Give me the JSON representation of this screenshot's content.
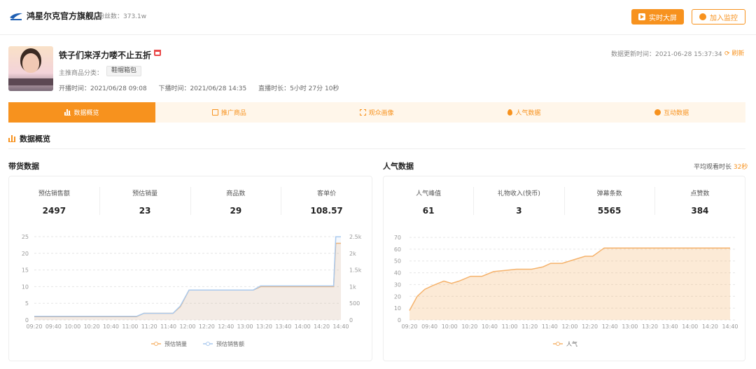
{
  "header": {
    "shop_name": "鸿星尔克官方旗舰店",
    "fans": "粉丝数：373.1w",
    "live_screen_label": "实时大屏",
    "monitor_label": "加入监控"
  },
  "live": {
    "title": "铁子们来浮力喽不止五折",
    "category_label": "主推商品分类：",
    "category_tag": "鞋帽箱包",
    "start_time": "开播时间：2021/06/28 09:08",
    "end_time": "下播时间：2021/06/28 14:35",
    "duration": "直播时长：5小时 27分 10秒",
    "updated": "数据更新时间：2021-06-28 15:37:34",
    "refresh": "刷新"
  },
  "tabs": [
    {
      "label": "数据概览",
      "icon": "bar-chart-icon",
      "active": true
    },
    {
      "label": "推广商品",
      "icon": "shopping-bag-icon",
      "active": false
    },
    {
      "label": "观众画像",
      "icon": "portrait-frame-icon",
      "active": false
    },
    {
      "label": "人气数据",
      "icon": "fire-icon",
      "active": false
    },
    {
      "label": "互动数据",
      "icon": "chat-icon",
      "active": false
    }
  ],
  "section_title": "数据概览",
  "sales": {
    "title": "带货数据",
    "stats": [
      {
        "label": "预估销售额",
        "value": "2497"
      },
      {
        "label": "预估销量",
        "value": "23"
      },
      {
        "label": "商品数",
        "value": "29"
      },
      {
        "label": "客单价",
        "value": "108.57"
      }
    ]
  },
  "popularity": {
    "title": "人气数据",
    "avg_watch_label": "平均观看时长",
    "avg_watch_value": "32秒",
    "stats": [
      {
        "label": "人气峰值",
        "value": "61"
      },
      {
        "label": "礼物收入(快币)",
        "value": "3"
      },
      {
        "label": "弹幕条数",
        "value": "5565"
      },
      {
        "label": "点赞数",
        "value": "384"
      }
    ]
  },
  "colors": {
    "accent": "#f7921e",
    "series_orange": "#f5b26b",
    "series_blue": "#a9c9ee"
  },
  "chart_data": [
    {
      "type": "line",
      "x": [
        "09:20",
        "09:40",
        "10:00",
        "10:20",
        "10:40",
        "11:00",
        "11:20",
        "11:40",
        "12:00",
        "12:20",
        "12:40",
        "13:00",
        "13:20",
        "13:40",
        "14:00",
        "14:20",
        "14:40"
      ],
      "x_ticks": [
        "09:20",
        "09:40",
        "10:00",
        "10:20",
        "10:40",
        "11:00",
        "11:20",
        "11:40",
        "12:00",
        "12:20",
        "12:40",
        "13:00",
        "13:20",
        "13:40",
        "14:00",
        "14:20",
        "14:40"
      ],
      "y_left_ticks": [
        "0",
        "5",
        "10",
        "15",
        "20",
        "25"
      ],
      "y_right_ticks": [
        "0",
        "500",
        "1k",
        "1.5k",
        "2k",
        "2.5k"
      ],
      "ylim_left": [
        0,
        25
      ],
      "ylim_right": [
        0,
        2500
      ],
      "series": [
        {
          "name": "预估销量",
          "axis": "left",
          "color": "#f5b26b",
          "points": [
            [
              0,
              1
            ],
            [
              140,
              1
            ],
            [
              150,
              2
            ],
            [
              190,
              2
            ],
            [
              200,
              4
            ],
            [
              212,
              9
            ],
            [
              300,
              9
            ],
            [
              310,
              10
            ],
            [
              400,
              10
            ],
            [
              410,
              10
            ],
            [
              413,
              23
            ],
            [
              420,
              23
            ]
          ]
        },
        {
          "name": "预估销售额",
          "axis": "right",
          "color": "#a9c9ee",
          "points": [
            [
              0,
              110
            ],
            [
              140,
              110
            ],
            [
              150,
              200
            ],
            [
              190,
              200
            ],
            [
              200,
              420
            ],
            [
              212,
              900
            ],
            [
              300,
              900
            ],
            [
              310,
              1020
            ],
            [
              400,
              1020
            ],
            [
              410,
              1020
            ],
            [
              413,
              2497
            ],
            [
              420,
              2497
            ]
          ]
        }
      ],
      "legend": "bottom",
      "grid": true
    },
    {
      "type": "area",
      "x": [
        "09:20",
        "09:40",
        "10:00",
        "10:20",
        "10:40",
        "11:00",
        "11:20",
        "11:40",
        "12:00",
        "12:20",
        "12:40",
        "13:00",
        "13:20",
        "13:40",
        "14:00",
        "14:20",
        "14:40"
      ],
      "x_ticks": [
        "09:20",
        "09:40",
        "10:00",
        "10:20",
        "10:40",
        "11:00",
        "11:20",
        "11:40",
        "12:00",
        "12:20",
        "12:40",
        "13:00",
        "13:20",
        "13:40",
        "14:00",
        "14:20",
        "14:40"
      ],
      "y_ticks": [
        "0",
        "10",
        "20",
        "30",
        "40",
        "50",
        "60",
        "70"
      ],
      "ylim": [
        0,
        70
      ],
      "series": [
        {
          "name": "人气",
          "color": "#f5b26b",
          "points": [
            [
              0,
              8
            ],
            [
              10,
              20
            ],
            [
              20,
              26
            ],
            [
              30,
              29
            ],
            [
              45,
              33
            ],
            [
              55,
              31
            ],
            [
              65,
              33
            ],
            [
              80,
              37
            ],
            [
              95,
              37
            ],
            [
              110,
              41
            ],
            [
              125,
              42
            ],
            [
              140,
              43
            ],
            [
              160,
              43
            ],
            [
              175,
              45
            ],
            [
              185,
              48
            ],
            [
              200,
              48
            ],
            [
              215,
              51
            ],
            [
              230,
              54
            ],
            [
              240,
              54
            ],
            [
              255,
              61
            ],
            [
              420,
              61
            ]
          ]
        }
      ],
      "legend": "bottom",
      "grid": true
    }
  ]
}
